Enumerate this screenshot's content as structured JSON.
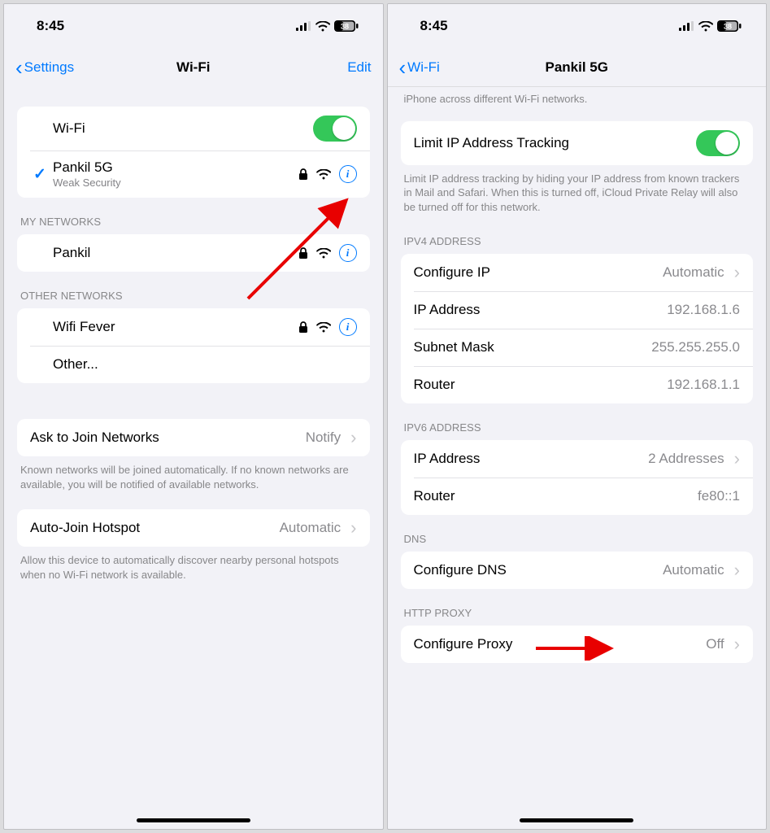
{
  "left": {
    "status_time": "8:45",
    "battery": "38",
    "nav_back": "Settings",
    "nav_title": "Wi-Fi",
    "nav_edit": "Edit",
    "wifi_row_label": "Wi-Fi",
    "connected_name": "Pankil 5G",
    "connected_sub": "Weak Security",
    "my_networks_header": "MY NETWORKS",
    "my_network_1": "Pankil",
    "other_networks_header": "OTHER NETWORKS",
    "other_network_1": "Wifi Fever",
    "other_row": "Other...",
    "ask_join_label": "Ask to Join Networks",
    "ask_join_value": "Notify",
    "ask_join_footer": "Known networks will be joined automatically. If no known networks are available, you will be notified of available networks.",
    "auto_hotspot_label": "Auto-Join Hotspot",
    "auto_hotspot_value": "Automatic",
    "auto_hotspot_footer": "Allow this device to automatically discover nearby personal hotspots when no Wi-Fi network is available."
  },
  "right": {
    "status_time": "8:45",
    "battery": "38",
    "nav_back": "Wi-Fi",
    "nav_title": "Pankil 5G",
    "top_footer": "iPhone across different Wi-Fi networks.",
    "limit_ip_label": "Limit IP Address Tracking",
    "limit_ip_footer": "Limit IP address tracking by hiding your IP address from known trackers in Mail and Safari. When this is turned off, iCloud Private Relay will also be turned off for this network.",
    "ipv4_header": "IPV4 ADDRESS",
    "configure_ip_label": "Configure IP",
    "configure_ip_value": "Automatic",
    "ip_addr_label": "IP Address",
    "ip_addr_value": "192.168.1.6",
    "subnet_label": "Subnet Mask",
    "subnet_value": "255.255.255.0",
    "router_label": "Router",
    "router_value": "192.168.1.1",
    "ipv6_header": "IPV6 ADDRESS",
    "ipv6_addr_label": "IP Address",
    "ipv6_addr_value": "2 Addresses",
    "ipv6_router_label": "Router",
    "ipv6_router_value": "fe80::1",
    "dns_header": "DNS",
    "configure_dns_label": "Configure DNS",
    "configure_dns_value": "Automatic",
    "http_proxy_header": "HTTP PROXY",
    "configure_proxy_label": "Configure Proxy",
    "configure_proxy_value": "Off"
  }
}
